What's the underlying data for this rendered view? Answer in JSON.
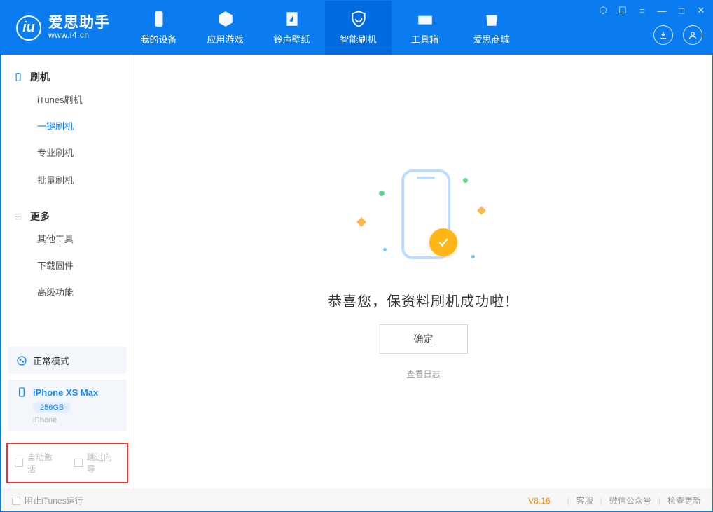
{
  "app": {
    "name_cn": "爱思助手",
    "name_en": "www.i4.cn"
  },
  "tabs": {
    "device": "我的设备",
    "apps": "应用游戏",
    "ring": "铃声壁纸",
    "flash": "智能刷机",
    "toolbox": "工具箱",
    "store": "爱思商城"
  },
  "sidebar": {
    "group_flash": "刷机",
    "items_flash": [
      "iTunes刷机",
      "一键刷机",
      "专业刷机",
      "批量刷机"
    ],
    "group_more": "更多",
    "items_more": [
      "其他工具",
      "下载固件",
      "高级功能"
    ],
    "mode_card": {
      "label": "正常模式"
    },
    "device_card": {
      "name": "iPhone XS Max",
      "storage": "256GB",
      "type": "iPhone"
    },
    "opt_auto_activate": "自动激活",
    "opt_skip_guide": "跳过向导"
  },
  "main": {
    "success_text": "恭喜您，保资料刷机成功啦！",
    "ok_button": "确定",
    "view_log": "查看日志"
  },
  "footer": {
    "block_itunes": "阻止iTunes运行",
    "version": "V8.16",
    "support": "客服",
    "wechat": "微信公众号",
    "update": "检查更新"
  }
}
